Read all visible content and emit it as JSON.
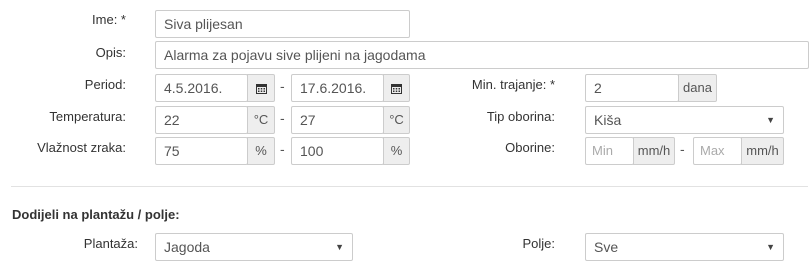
{
  "form": {
    "name": {
      "label": "Ime: *",
      "value": "Siva plijesan"
    },
    "description": {
      "label": "Opis:",
      "value": "Alarma za pojavu sive plijeni na jagodama"
    },
    "period": {
      "label": "Period:",
      "from": "4.5.2016.",
      "to": "17.6.2016.",
      "separator": "-"
    },
    "min_duration": {
      "label": "Min. trajanje: *",
      "value": "2",
      "unit": "dana"
    },
    "temperature": {
      "label": "Temperatura:",
      "from": "22",
      "to": "27",
      "unit": "°C",
      "separator": "-"
    },
    "precipitation_type": {
      "label": "Tip oborina:",
      "value": "Kiša"
    },
    "humidity": {
      "label": "Vlažnost zraka:",
      "from": "75",
      "to": "100",
      "unit": "%",
      "separator": "-"
    },
    "precipitation": {
      "label": "Oborine:",
      "min_placeholder": "Min",
      "max_placeholder": "Max",
      "unit": "mm/h",
      "separator": "-"
    }
  },
  "assign": {
    "heading": "Dodijeli na plantažu / polje:",
    "plantation": {
      "label": "Plantaža:",
      "value": "Jagoda"
    },
    "field": {
      "label": "Polje:",
      "value": "Sve"
    }
  },
  "icons": {
    "calendar": "calendar-icon",
    "dropdown": "caret-down-icon"
  },
  "colors": {
    "border": "#cccccc",
    "addon_bg": "#eeeeee",
    "text": "#333333",
    "placeholder": "#aaaaaa"
  }
}
